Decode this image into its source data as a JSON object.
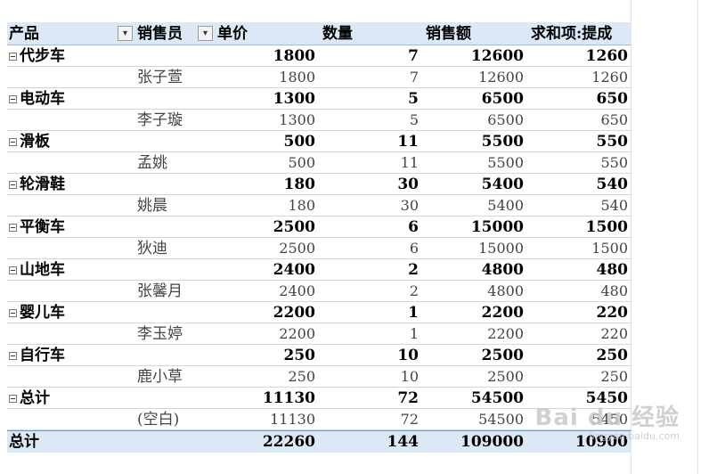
{
  "headers": {
    "product": "产品",
    "seller": "销售员",
    "price": "单价",
    "qty": "数量",
    "sales": "销售额",
    "commission": "求和项:提成"
  },
  "groups": [
    {
      "product": "代步车",
      "price": "1800",
      "qty": "7",
      "sales": "12600",
      "commission": "1260",
      "detail": {
        "seller": "张子萱",
        "price": "1800",
        "qty": "7",
        "sales": "12600",
        "commission": "1260"
      }
    },
    {
      "product": "电动车",
      "price": "1300",
      "qty": "5",
      "sales": "6500",
      "commission": "650",
      "detail": {
        "seller": "李子璇",
        "price": "1300",
        "qty": "5",
        "sales": "6500",
        "commission": "650"
      }
    },
    {
      "product": "滑板",
      "price": "500",
      "qty": "11",
      "sales": "5500",
      "commission": "550",
      "detail": {
        "seller": "孟姚",
        "price": "500",
        "qty": "11",
        "sales": "5500",
        "commission": "550"
      }
    },
    {
      "product": "轮滑鞋",
      "price": "180",
      "qty": "30",
      "sales": "5400",
      "commission": "540",
      "detail": {
        "seller": "姚晨",
        "price": "180",
        "qty": "30",
        "sales": "5400",
        "commission": "540"
      }
    },
    {
      "product": "平衡车",
      "price": "2500",
      "qty": "6",
      "sales": "15000",
      "commission": "1500",
      "detail": {
        "seller": "狄迪",
        "price": "2500",
        "qty": "6",
        "sales": "15000",
        "commission": "1500"
      }
    },
    {
      "product": "山地车",
      "price": "2400",
      "qty": "2",
      "sales": "4800",
      "commission": "480",
      "detail": {
        "seller": "张馨月",
        "price": "2400",
        "qty": "2",
        "sales": "4800",
        "commission": "480"
      }
    },
    {
      "product": "婴儿车",
      "price": "2200",
      "qty": "1",
      "sales": "2200",
      "commission": "220",
      "detail": {
        "seller": "李玉婷",
        "price": "2200",
        "qty": "1",
        "sales": "2200",
        "commission": "220"
      }
    },
    {
      "product": "自行车",
      "price": "250",
      "qty": "10",
      "sales": "2500",
      "commission": "250",
      "detail": {
        "seller": "鹿小草",
        "price": "250",
        "qty": "10",
        "sales": "2500",
        "commission": "250"
      }
    },
    {
      "product": "总计",
      "price": "11130",
      "qty": "72",
      "sales": "54500",
      "commission": "5450",
      "detail": {
        "seller": "(空白)",
        "price": "11130",
        "qty": "72",
        "sales": "54500",
        "commission": "5450"
      }
    }
  ],
  "grand_total": {
    "label": "总计",
    "price": "22260",
    "qty": "144",
    "sales": "109000",
    "commission": "10900"
  },
  "watermark": {
    "brand": "Bai du 经验",
    "sub": "jingyan.baidu.com"
  }
}
